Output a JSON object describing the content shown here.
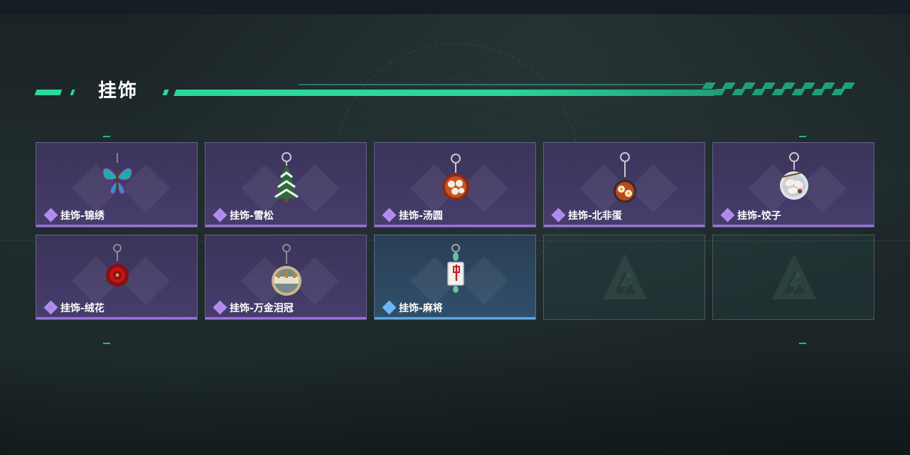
{
  "section": {
    "title": "挂饰"
  },
  "items": [
    {
      "label": "挂饰-锦绣",
      "rarity": "purple",
      "icon": "butterfly-charm-icon"
    },
    {
      "label": "挂饰-雪松",
      "rarity": "purple",
      "icon": "snow-pine-charm-icon"
    },
    {
      "label": "挂饰-汤圆",
      "rarity": "purple",
      "icon": "tangyuan-bowl-charm-icon"
    },
    {
      "label": "挂饰-北非蛋",
      "rarity": "purple",
      "icon": "shakshuka-pan-charm-icon"
    },
    {
      "label": "挂饰-饺子",
      "rarity": "purple",
      "icon": "dumpling-plate-charm-icon"
    },
    {
      "label": "挂饰-绒花",
      "rarity": "purple",
      "icon": "red-flower-charm-icon"
    },
    {
      "label": "挂饰-万金泪冠",
      "rarity": "purple",
      "icon": "crown-orb-charm-icon"
    },
    {
      "label": "挂饰-麻将",
      "rarity": "blue",
      "icon": "mahjong-tile-charm-icon"
    },
    {
      "label": "",
      "rarity": "empty",
      "icon": "empty-slot-logo-icon"
    },
    {
      "label": "",
      "rarity": "empty",
      "icon": "empty-slot-logo-icon"
    }
  ],
  "colors": {
    "accent": "#2bd89b",
    "purple": "#9a6fe0",
    "blue": "#5aa6e6"
  }
}
